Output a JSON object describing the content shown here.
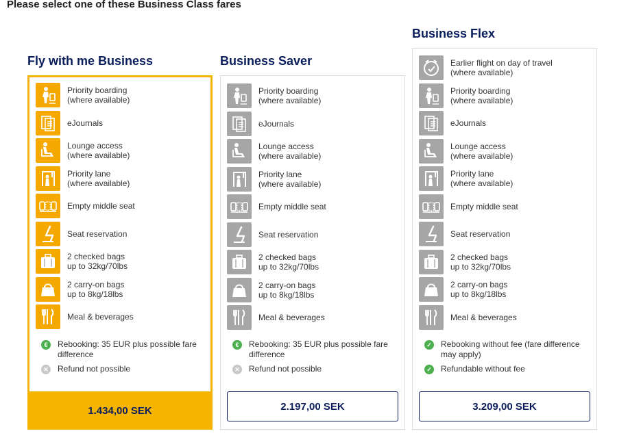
{
  "heading": "Please select one of these Business Class fares",
  "fares": [
    {
      "title": "Fly with me Business",
      "price": "1.434,00 SEK",
      "selected": true,
      "features": [
        {
          "icon": "priority-boarding-icon",
          "line1": "Priority boarding",
          "line2": "(where available)"
        },
        {
          "icon": "ejournals-icon",
          "line1": "eJournals",
          "line2": ""
        },
        {
          "icon": "lounge-access-icon",
          "line1": "Lounge access",
          "line2": "(where available)"
        },
        {
          "icon": "priority-lane-icon",
          "line1": "Priority lane",
          "line2": "(where available)"
        },
        {
          "icon": "empty-middle-seat-icon",
          "line1": "Empty middle seat",
          "line2": ""
        },
        {
          "icon": "seat-reservation-icon",
          "line1": "Seat reservation",
          "line2": ""
        },
        {
          "icon": "checked-bags-icon",
          "line1": "2 checked bags",
          "line2": "up to 32kg/70lbs"
        },
        {
          "icon": "carry-on-bags-icon",
          "line1": "2 carry-on bags",
          "line2": "up to 8kg/18lbs"
        },
        {
          "icon": "meal-icon",
          "line1": "Meal & beverages",
          "line2": ""
        }
      ],
      "conditions": [
        {
          "icon": "euro-icon",
          "text": "Rebooking: 35 EUR plus possible fare difference"
        },
        {
          "icon": "cross-icon",
          "text": "Refund not possible"
        }
      ]
    },
    {
      "title": "Business Saver",
      "price": "2.197,00 SEK",
      "selected": false,
      "features": [
        {
          "icon": "priority-boarding-icon",
          "line1": "Priority boarding",
          "line2": "(where available)"
        },
        {
          "icon": "ejournals-icon",
          "line1": "eJournals",
          "line2": ""
        },
        {
          "icon": "lounge-access-icon",
          "line1": "Lounge access",
          "line2": "(where available)"
        },
        {
          "icon": "priority-lane-icon",
          "line1": "Priority lane",
          "line2": "(where available)"
        },
        {
          "icon": "empty-middle-seat-icon",
          "line1": "Empty middle seat",
          "line2": ""
        },
        {
          "icon": "seat-reservation-icon",
          "line1": "Seat reservation",
          "line2": ""
        },
        {
          "icon": "checked-bags-icon",
          "line1": "2 checked bags",
          "line2": "up to 32kg/70lbs"
        },
        {
          "icon": "carry-on-bags-icon",
          "line1": "2 carry-on bags",
          "line2": "up to 8kg/18lbs"
        },
        {
          "icon": "meal-icon",
          "line1": "Meal & beverages",
          "line2": ""
        }
      ],
      "conditions": [
        {
          "icon": "euro-icon",
          "text": "Rebooking: 35 EUR plus possible fare difference"
        },
        {
          "icon": "cross-icon",
          "text": "Refund not possible"
        }
      ]
    },
    {
      "title": "Business Flex",
      "price": "3.209,00 SEK",
      "selected": false,
      "features": [
        {
          "icon": "earlier-flight-icon",
          "line1": "Earlier flight on day of travel",
          "line2": "(where available)"
        },
        {
          "icon": "priority-boarding-icon",
          "line1": "Priority boarding",
          "line2": "(where available)"
        },
        {
          "icon": "ejournals-icon",
          "line1": "eJournals",
          "line2": ""
        },
        {
          "icon": "lounge-access-icon",
          "line1": "Lounge access",
          "line2": "(where available)"
        },
        {
          "icon": "priority-lane-icon",
          "line1": "Priority lane",
          "line2": "(where available)"
        },
        {
          "icon": "empty-middle-seat-icon",
          "line1": "Empty middle seat",
          "line2": ""
        },
        {
          "icon": "seat-reservation-icon",
          "line1": "Seat reservation",
          "line2": ""
        },
        {
          "icon": "checked-bags-icon",
          "line1": "2 checked bags",
          "line2": "up to 32kg/70lbs"
        },
        {
          "icon": "carry-on-bags-icon",
          "line1": "2 carry-on bags",
          "line2": "up to 8kg/18lbs"
        },
        {
          "icon": "meal-icon",
          "line1": "Meal & beverages",
          "line2": ""
        }
      ],
      "conditions": [
        {
          "icon": "check-icon",
          "text": "Rebooking without fee (fare difference may apply)"
        },
        {
          "icon": "check-icon",
          "text": "Refundable without fee"
        }
      ]
    }
  ],
  "colors": {
    "accent": "#f5b400",
    "navy": "#0a1d5c",
    "tile_yellow": "#f5a900",
    "tile_grey": "#a6a6a6",
    "green": "#4caf50"
  }
}
